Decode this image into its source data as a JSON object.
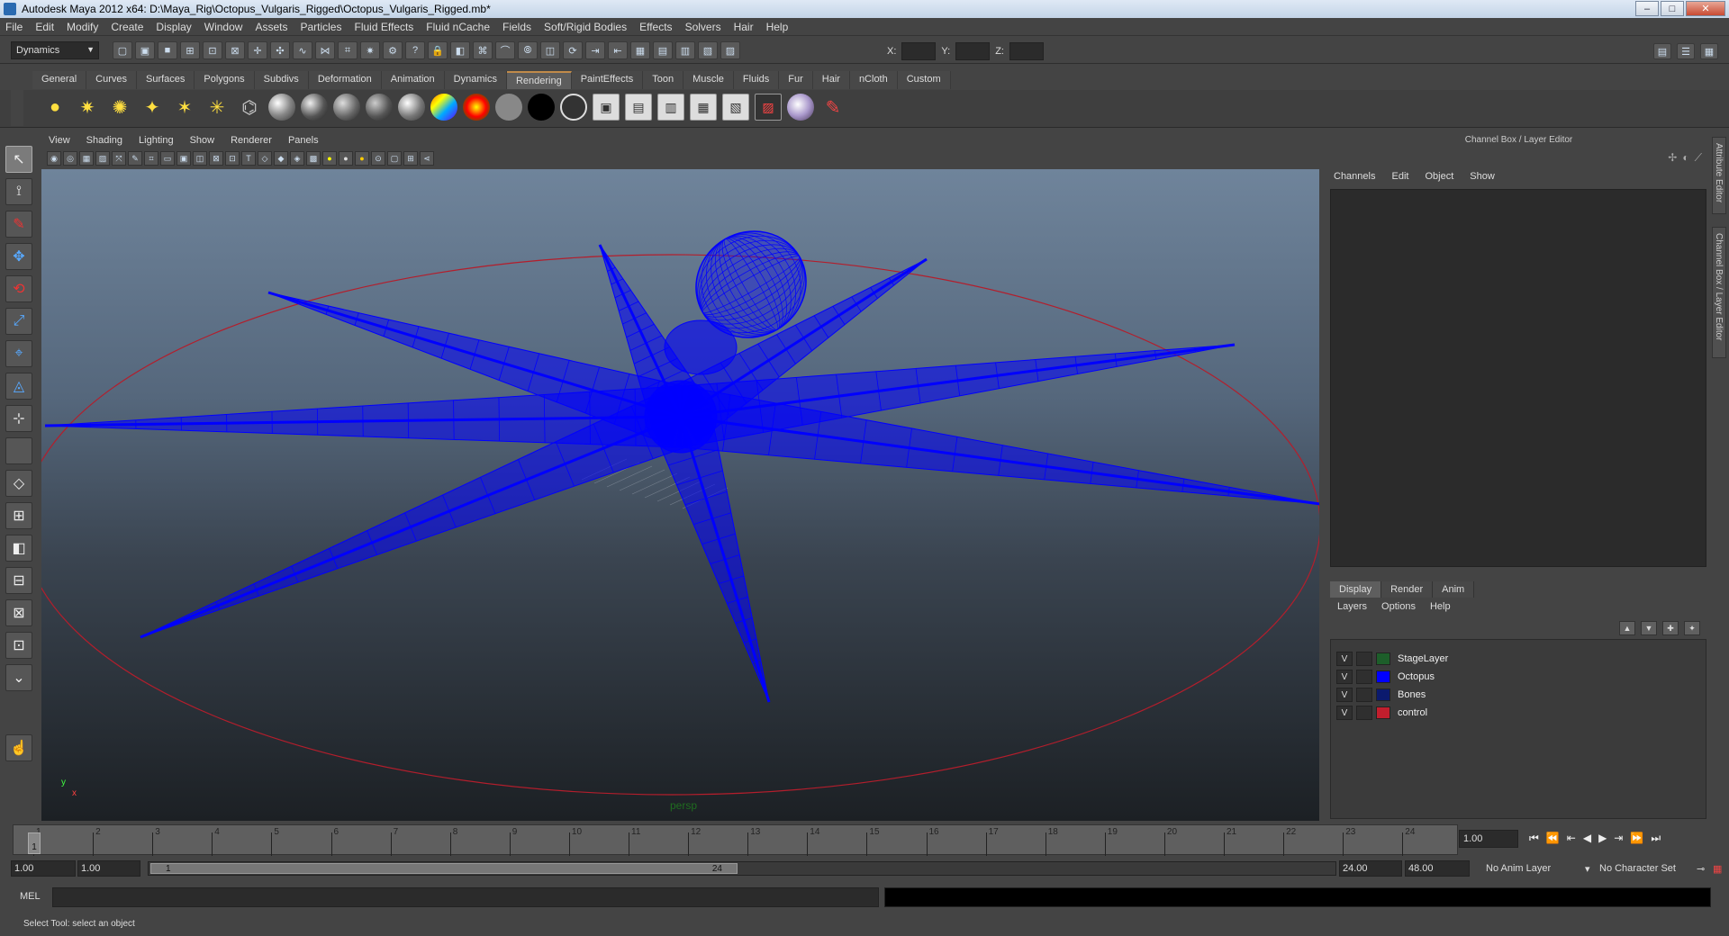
{
  "window": {
    "title": "Autodesk Maya 2012 x64: D:\\Maya_Rig\\Octopus_Vulgaris_Rigged\\Octopus_Vulgaris_Rigged.mb*",
    "minimize": "–",
    "maximize": "□",
    "close": "✕"
  },
  "menubar": [
    "File",
    "Edit",
    "Modify",
    "Create",
    "Display",
    "Window",
    "Assets",
    "Particles",
    "Fluid Effects",
    "Fluid nCache",
    "Fields",
    "Soft/Rigid Bodies",
    "Effects",
    "Solvers",
    "Hair",
    "Help"
  ],
  "statusline": {
    "mode": "Dynamics",
    "x_label": "X:",
    "y_label": "Y:",
    "z_label": "Z:"
  },
  "shelf": {
    "tabs": [
      "General",
      "Curves",
      "Surfaces",
      "Polygons",
      "Subdivs",
      "Deformation",
      "Animation",
      "Dynamics",
      "Rendering",
      "PaintEffects",
      "Toon",
      "Muscle",
      "Fluids",
      "Fur",
      "Hair",
      "nCloth",
      "Custom"
    ],
    "active_tab": "Rendering"
  },
  "viewport": {
    "menu": [
      "View",
      "Shading",
      "Lighting",
      "Show",
      "Renderer",
      "Panels"
    ],
    "camera": "persp",
    "axis_x": "x",
    "axis_y": "y",
    "wire_color": "#0000ff",
    "control_color": "#b31e2c"
  },
  "channel_box": {
    "title": "Channel Box / Layer Editor",
    "menu": [
      "Channels",
      "Edit",
      "Object",
      "Show"
    ]
  },
  "layer_editor": {
    "tabs": [
      "Display",
      "Render",
      "Anim"
    ],
    "menu": [
      "Layers",
      "Options",
      "Help"
    ],
    "layers": [
      {
        "visible": "V",
        "name": "StageLayer",
        "color": "#1d5e2a"
      },
      {
        "visible": "V",
        "name": "Octopus",
        "color": "#0000ff"
      },
      {
        "visible": "V",
        "name": "Bones",
        "color": "#0b1a6e"
      },
      {
        "visible": "V",
        "name": "control",
        "color": "#c11e2d"
      }
    ]
  },
  "side_tabs": [
    "Attribute Editor",
    "Channel Box / Layer Editor"
  ],
  "timeline": {
    "frames": [
      "1",
      "2",
      "3",
      "4",
      "5",
      "6",
      "7",
      "8",
      "9",
      "10",
      "11",
      "12",
      "13",
      "14",
      "15",
      "16",
      "17",
      "18",
      "19",
      "20",
      "21",
      "22",
      "23",
      "24"
    ],
    "current_marker": "1",
    "current_frame": "1.00"
  },
  "range": {
    "start": "1.00",
    "playback_start": "1.00",
    "thumb_start": "1",
    "thumb_end": "24",
    "playback_end": "24.00",
    "end": "48.00",
    "anim_layer": "No Anim Layer",
    "character_set": "No Character Set"
  },
  "command_line": {
    "label": "MEL"
  },
  "help_line": "Select Tool: select an object"
}
